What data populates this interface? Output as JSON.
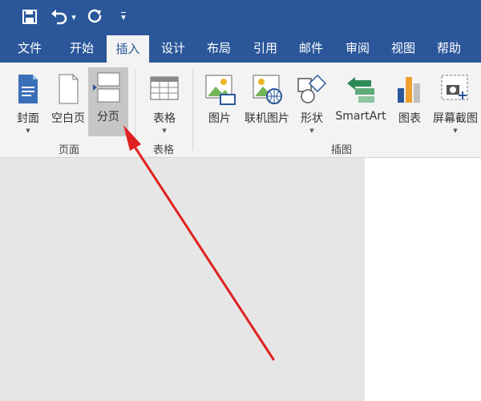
{
  "quick_access": {
    "save_icon": "save-icon",
    "undo_icon": "undo-icon",
    "undo_dropdown": "▾",
    "redo_icon": "redo-icon",
    "customize_icon": "▾"
  },
  "tabs": [
    "文件",
    "开始",
    "插入",
    "设计",
    "布局",
    "引用",
    "邮件",
    "审阅",
    "视图",
    "帮助"
  ],
  "active_tab": "插入",
  "groups": {
    "pages": {
      "label": "页面",
      "buttons": {
        "cover": "封面",
        "blank": "空白页",
        "break": "分页"
      }
    },
    "tables": {
      "label": "表格",
      "buttons": {
        "table": "表格"
      }
    },
    "illustrations": {
      "label": "插图",
      "buttons": {
        "picture": "图片",
        "online_picture": "联机图片",
        "shapes": "形状",
        "smartart": "SmartArt",
        "chart": "图表",
        "screenshot": "屏幕截图"
      }
    }
  },
  "colors": {
    "title_bar": "#2b579a",
    "ribbon_bg": "#f3f3f3",
    "annotation_arrow": "#e02020"
  }
}
